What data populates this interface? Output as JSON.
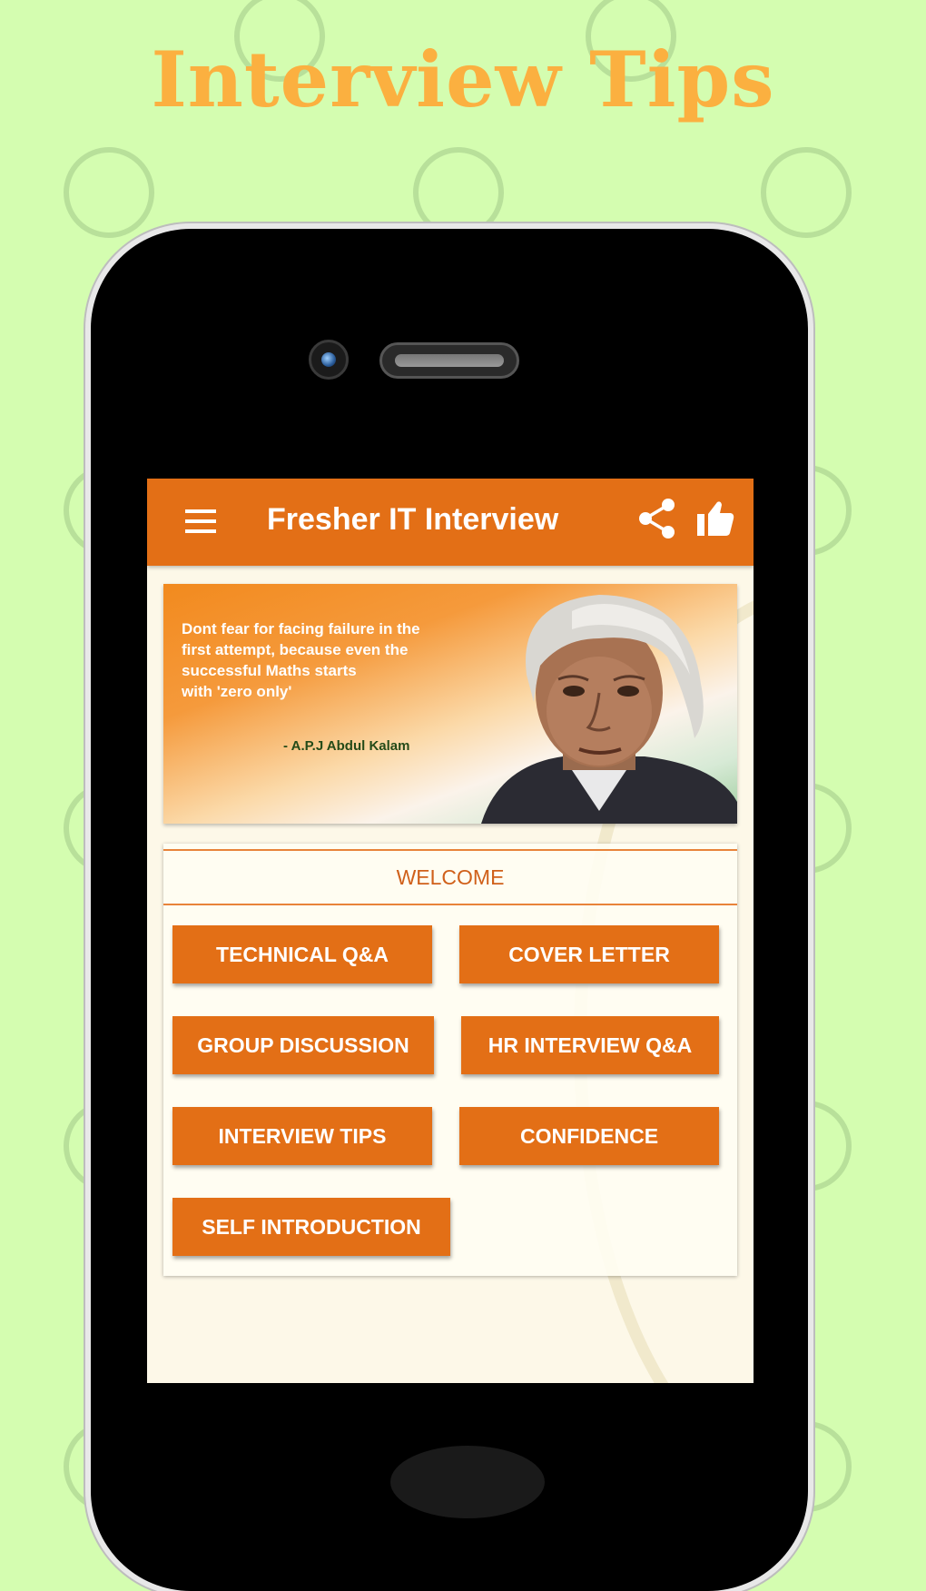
{
  "promo": {
    "title": "Interview Tips",
    "background_color": "#d4fdb0",
    "title_color": "#fbb040"
  },
  "app": {
    "title": "Fresher IT Interview",
    "accent_color": "#e36f16",
    "toolbar_icons": [
      "menu-icon",
      "share-icon",
      "thumbs-up-icon"
    ]
  },
  "banner": {
    "quote": "Dont fear for facing failure in the first attempt, because even the successful Maths starts with 'zero only'",
    "quote_lines": [
      "Dont fear for facing failure in the",
      "first attempt, because even the",
      "successful Maths starts",
      "with 'zero only'"
    ],
    "author": "- A.P.J Abdul Kalam"
  },
  "menu": {
    "welcome_label": "WELCOME",
    "buttons": [
      {
        "label": "TECHNICAL Q&A"
      },
      {
        "label": "COVER LETTER"
      },
      {
        "label": "GROUP DISCUSSION"
      },
      {
        "label": "HR INTERVIEW Q&A"
      },
      {
        "label": "INTERVIEW TIPS"
      },
      {
        "label": "CONFIDENCE"
      },
      {
        "label": "SELF INTRODUCTION"
      }
    ]
  }
}
